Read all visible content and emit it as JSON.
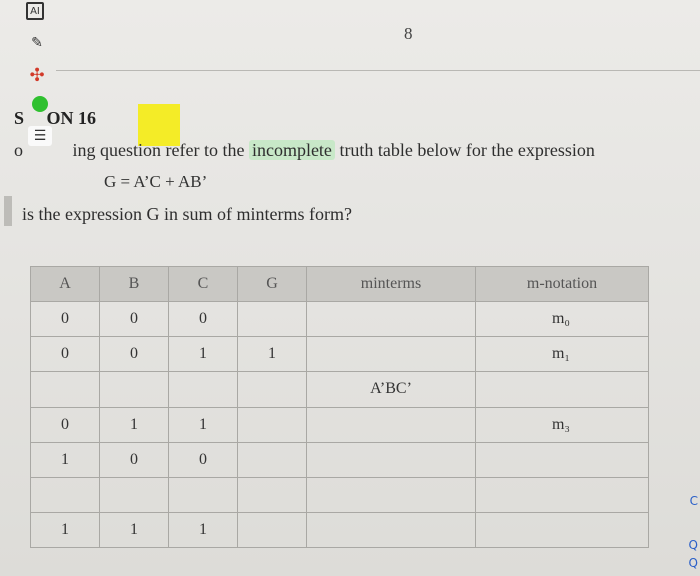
{
  "toolbar": {
    "icons": [
      "calculator-icon",
      "highlighter-icon",
      "pin-icon"
    ],
    "icon_glyphs": {
      "box": "AI",
      "draw": "✎",
      "pin": "✣"
    }
  },
  "page_number": "8",
  "question": {
    "heading": "ON 16",
    "line1_pre": "ing question refer to the ",
    "line1_highlight": "incomplete",
    "line1_post": " truth table below for the expression",
    "expression": "G = A’C + AB’",
    "line2": "is the expression G in sum of minterms form?"
  },
  "colors": {
    "highlight_green": "#c8e8c8",
    "note_yellow": "#f4ec1c",
    "status_green": "#2fc02f"
  },
  "table": {
    "headers": [
      "A",
      "B",
      "C",
      "G",
      "minterms",
      "m-notation"
    ],
    "rows": [
      [
        "0",
        "0",
        "0",
        "",
        "",
        "m₀"
      ],
      [
        "0",
        "0",
        "1",
        "1",
        "",
        "m₁"
      ],
      [
        "",
        "",
        "",
        "",
        "A’BC’",
        ""
      ],
      [
        "0",
        "1",
        "1",
        "",
        "",
        "m₃"
      ],
      [
        "1",
        "0",
        "0",
        "",
        "",
        ""
      ],
      [
        "",
        "",
        "",
        "",
        "",
        ""
      ],
      [
        "1",
        "1",
        "1",
        "",
        "",
        ""
      ]
    ]
  },
  "right_edge_glyphs": [
    "C",
    "Q",
    "Q"
  ]
}
